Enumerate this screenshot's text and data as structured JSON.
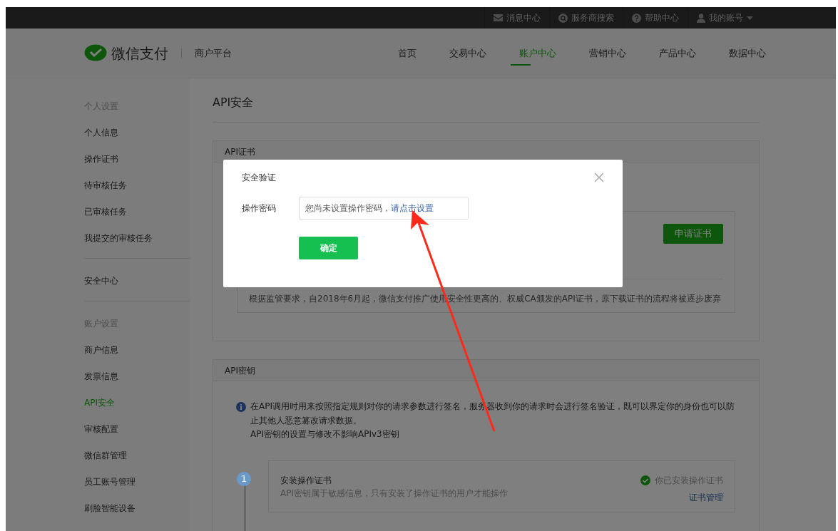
{
  "top_bar": {
    "items": [
      {
        "kind": "mail",
        "label": "消息中心"
      },
      {
        "kind": "search",
        "label": "服务商搜索"
      },
      {
        "kind": "help",
        "label": "帮助中心"
      },
      {
        "kind": "account",
        "label": "我的账号"
      }
    ]
  },
  "header": {
    "logo_text": "微信支付",
    "platform": "商户平台",
    "nav": [
      {
        "label": "首页",
        "selected": false
      },
      {
        "label": "交易中心",
        "selected": false
      },
      {
        "label": "账户中心",
        "selected": true
      },
      {
        "label": "营销中心",
        "selected": false
      },
      {
        "label": "产品中心",
        "selected": false
      },
      {
        "label": "数据中心",
        "selected": false
      }
    ]
  },
  "sidebar": {
    "groups": [
      {
        "title": "个人设置",
        "items": [
          {
            "label": "个人信息",
            "selected": false
          },
          {
            "label": "操作证书",
            "selected": false
          },
          {
            "label": "待审核任务",
            "selected": false
          },
          {
            "label": "已审核任务",
            "selected": false
          },
          {
            "label": "我提交的审核任务",
            "selected": false
          }
        ]
      },
      {
        "items": [
          {
            "label": "安全中心",
            "selected": false
          }
        ]
      },
      {
        "title": "账户设置",
        "items": [
          {
            "label": "商户信息",
            "selected": false
          },
          {
            "label": "发票信息",
            "selected": false
          },
          {
            "label": "API安全",
            "selected": true
          },
          {
            "label": "审核配置",
            "selected": false
          },
          {
            "label": "微信群管理",
            "selected": false
          },
          {
            "label": "员工账号管理",
            "selected": false
          },
          {
            "label": "刷脸智能设备",
            "selected": false
          }
        ]
      }
    ]
  },
  "page_title": "API安全",
  "cert_card": {
    "title": "API证书",
    "button": "申请证书",
    "notice": "根据监管要求，自2018年6月起，微信支付推广使用安全性更高的、权威CA颁发的API证书，原下载证书的流程将被逐步废弃"
  },
  "key_card": {
    "title": "API密钥",
    "info": [
      "在API调用时用来按照指定规则对你的请求参数进行签名，服务器收到你的请求时会进行签名验证，既可以界定你的身份也可以防止其他人恶意篡改请求数据。",
      "API密钥的设置与修改不影响APIv3密钥"
    ],
    "steps": [
      {
        "number": "1",
        "title": "安装操作证书",
        "description": "API密钥属于敏感信息，只有安装了操作证书的用户才能操作",
        "status": "你已安装操作证书",
        "done": true,
        "link": "证书管理"
      }
    ]
  },
  "dialog": {
    "title": "安全验证",
    "field_label": "操作密码",
    "field_text": "您尚未设置操作密码，",
    "field_link": "请点击设置",
    "button": "确定"
  }
}
